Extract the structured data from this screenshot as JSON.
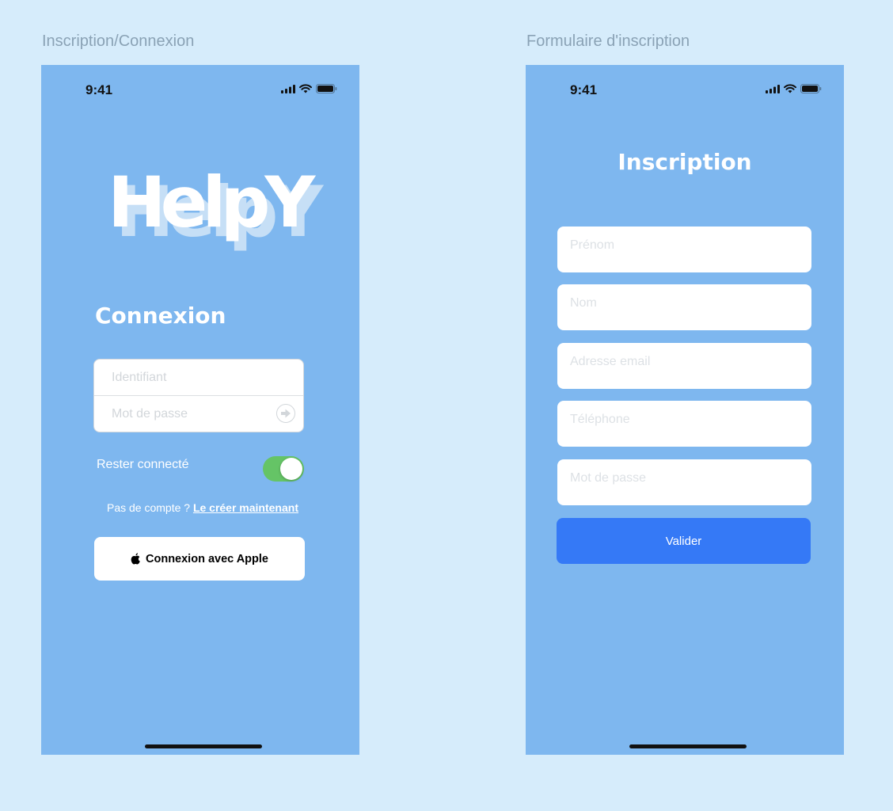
{
  "frames": {
    "left_label": "Inscription/Connexion",
    "right_label": "Formulaire d'inscription"
  },
  "status_bar": {
    "time": "9:41"
  },
  "login_screen": {
    "logo_text": "HelpY",
    "title": "Connexion",
    "username_placeholder": "Identifiant",
    "password_placeholder": "Mot de passe",
    "remember_label": "Rester connecté",
    "remember_enabled": true,
    "no_account_text": "Pas de compte ?",
    "create_link": "Le créer maintenant",
    "apple_button": "Connexion avec Apple"
  },
  "signup_screen": {
    "title": "Inscription",
    "fields": {
      "first_name": "Prénom",
      "last_name": "Nom",
      "email": "Adresse email",
      "phone": "Téléphone",
      "password": "Mot de passe"
    },
    "submit": "Valider"
  },
  "colors": {
    "page_background": "#d6ecfb",
    "phone_background": "#7eb7ef",
    "toggle_on": "#65c466",
    "submit_button": "#3579f6"
  }
}
